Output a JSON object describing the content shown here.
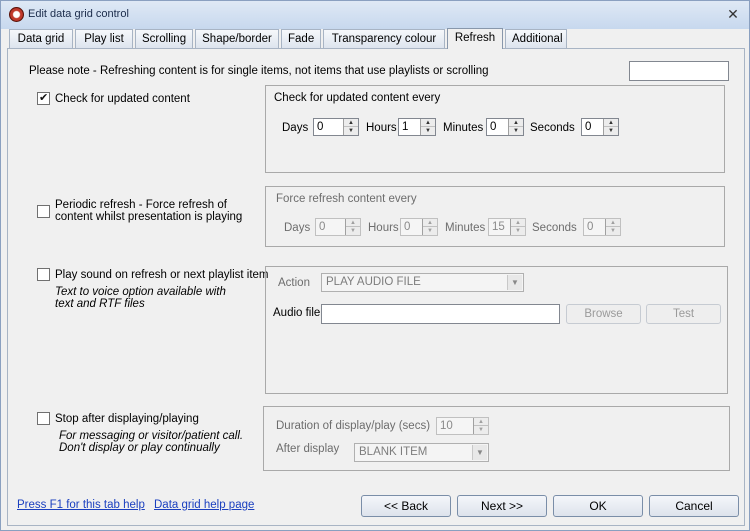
{
  "window": {
    "title": "Edit data grid control"
  },
  "tabs": [
    {
      "label": "Data grid"
    },
    {
      "label": "Play list"
    },
    {
      "label": "Scrolling"
    },
    {
      "label": "Shape/border"
    },
    {
      "label": "Fade"
    },
    {
      "label": "Transparency colour"
    },
    {
      "label": "Refresh"
    },
    {
      "label": "Additional"
    }
  ],
  "active_tab": "Refresh",
  "note": "Please note - Refreshing content is for single items, not items that use playlists or scrolling",
  "check_updated": {
    "label": "Check for updated content",
    "checked": true,
    "group_title": "Check for updated content every",
    "days_label": "Days",
    "days": "0",
    "hours_label": "Hours",
    "hours": "1",
    "minutes_label": "Minutes",
    "minutes": "0",
    "seconds_label": "Seconds",
    "seconds": "0"
  },
  "periodic_refresh": {
    "label_line1": "Periodic refresh - Force refresh of",
    "label_line2": "content whilst presentation is playing",
    "checked": false,
    "group_title": "Force refresh content every",
    "days_label": "Days",
    "days": "0",
    "hours_label": "Hours",
    "hours": "0",
    "minutes_label": "Minutes",
    "minutes": "15",
    "seconds_label": "Seconds",
    "seconds": "0"
  },
  "play_sound": {
    "label": "Play sound on refresh or next playlist item",
    "note_line1": "Text to voice option available with",
    "note_line2": "text and RTF files",
    "checked": false,
    "action_label": "Action",
    "action_value": "PLAY AUDIO FILE",
    "audio_file_label": "Audio file",
    "audio_file_value": "",
    "browse_label": "Browse",
    "test_label": "Test"
  },
  "stop_after": {
    "label": "Stop after displaying/playing",
    "note_line1": "For messaging or visitor/patient call.",
    "note_line2": "Don't display or play continually",
    "checked": false,
    "duration_label": "Duration of display/play (secs)",
    "duration_value": "10",
    "after_label": "After display",
    "after_value": "BLANK ITEM"
  },
  "footer": {
    "help_link": "Press F1 for this tab help",
    "page_link": "Data grid help page",
    "back": "<< Back",
    "next": "Next >>",
    "ok": "OK",
    "cancel": "Cancel"
  }
}
